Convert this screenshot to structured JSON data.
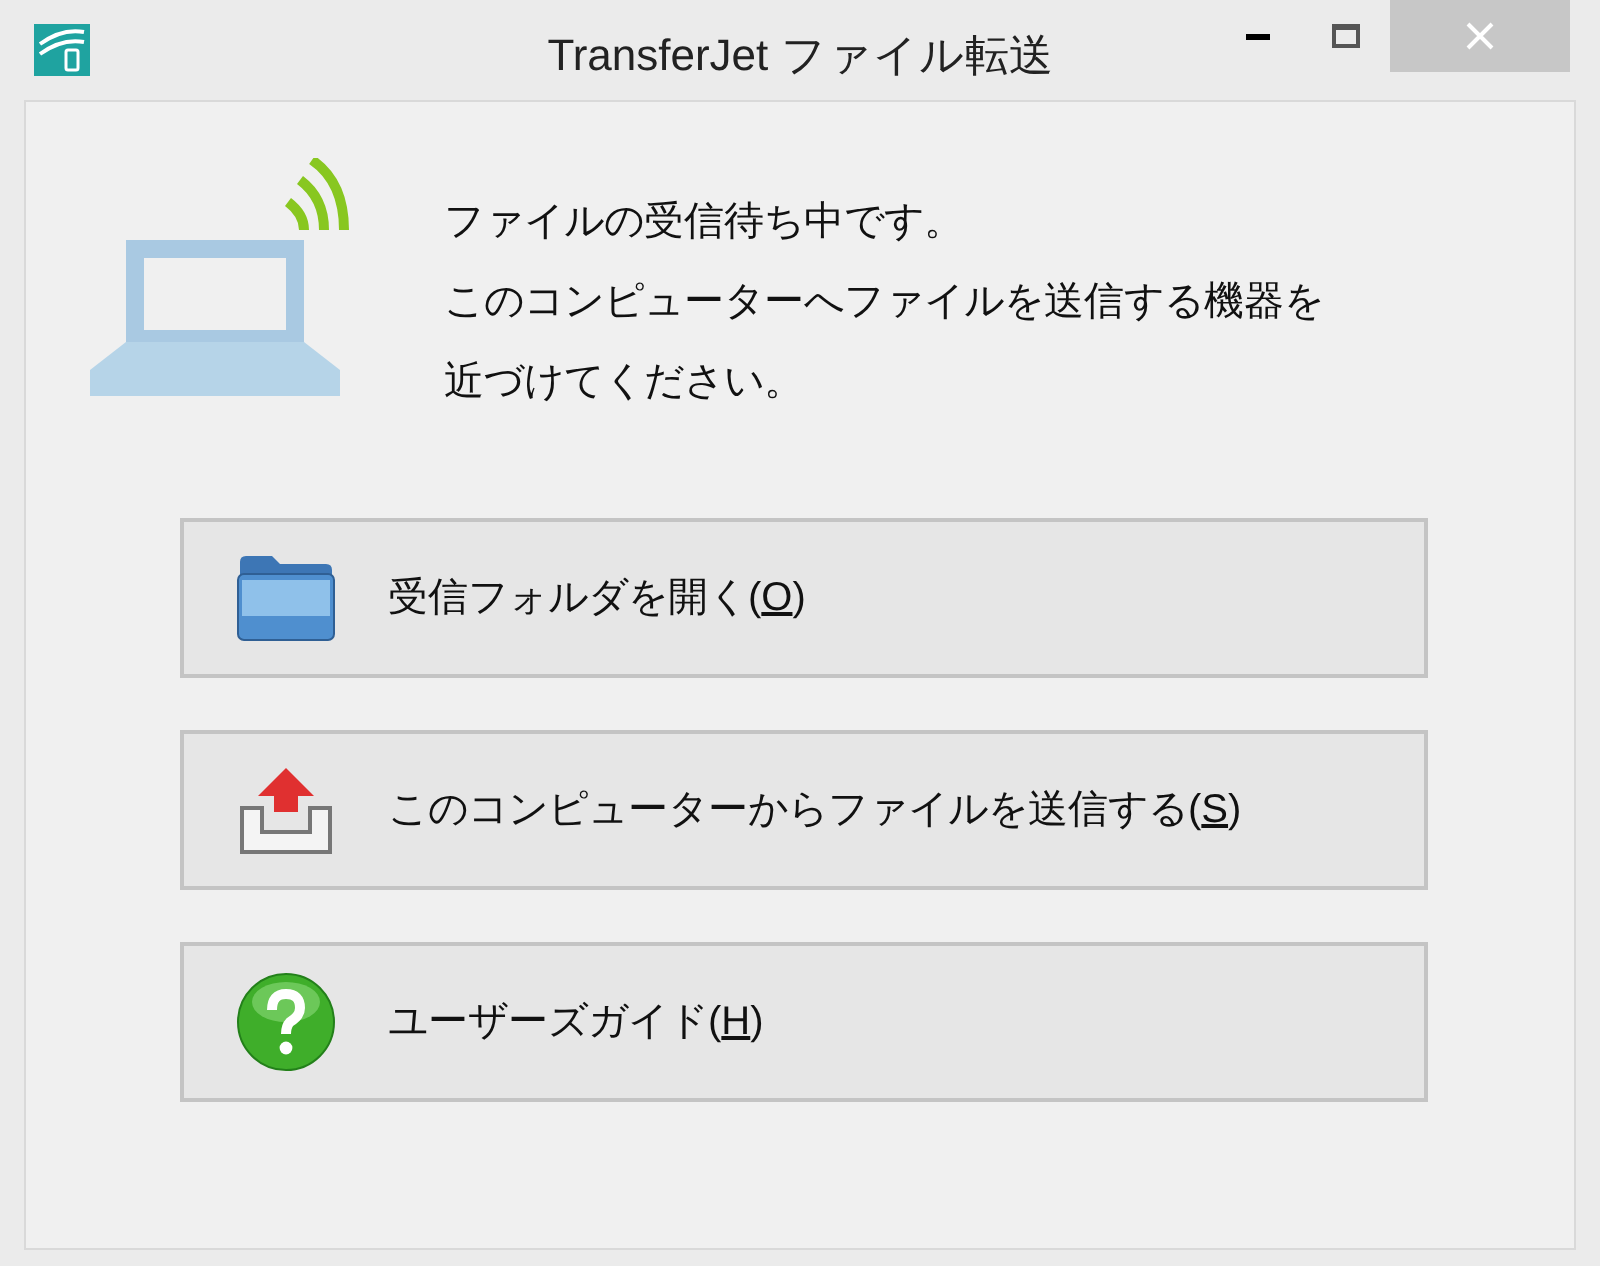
{
  "window": {
    "title": "TransferJet ファイル転送"
  },
  "message": [
    "ファイルの受信待ち中です。",
    "このコンピューターへファイルを送信する機器を",
    "近づけてください。"
  ],
  "buttons": [
    {
      "kind": "folder",
      "label_before": "受信フォルダを開く(",
      "access_key": "O",
      "label_after": ")"
    },
    {
      "kind": "send",
      "label_before": "このコンピューターからファイルを送信する(",
      "access_key": "S",
      "label_after": ")"
    },
    {
      "kind": "help",
      "label_before": "ユーザーズガイド(",
      "access_key": "H",
      "label_after": ")"
    }
  ]
}
